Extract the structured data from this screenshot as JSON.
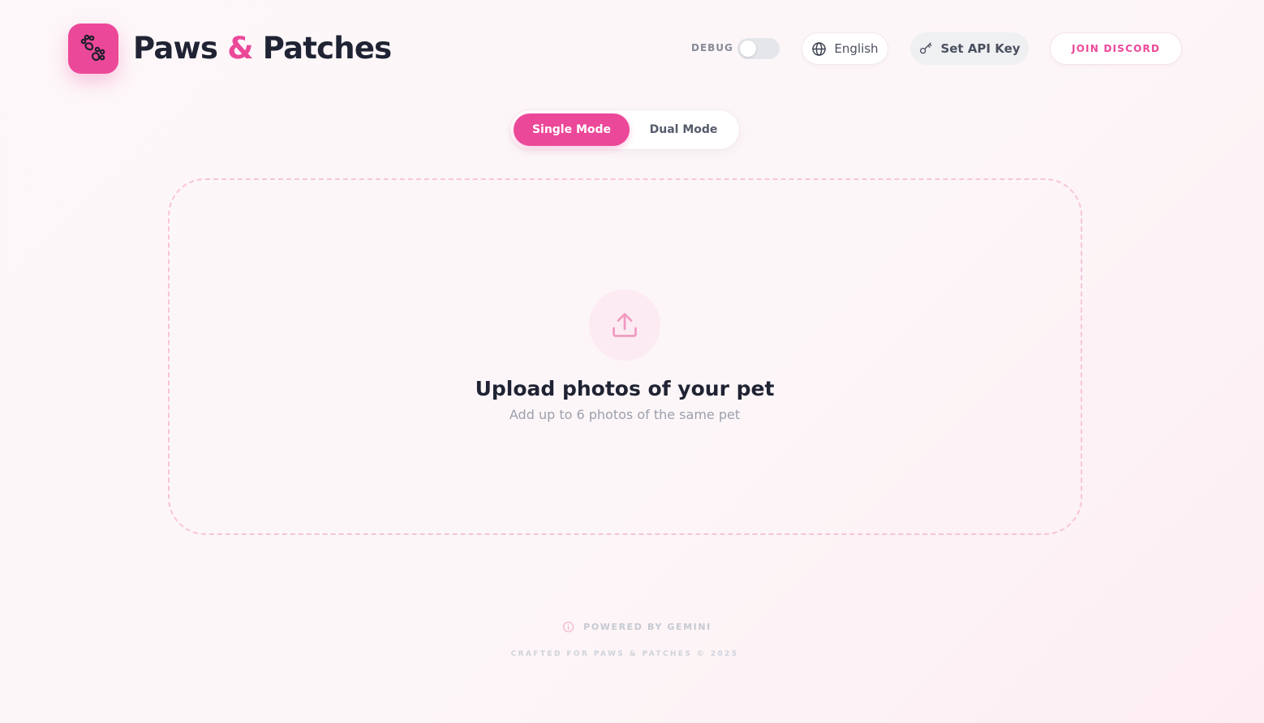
{
  "header": {
    "brand_part1": "Paws",
    "brand_amp": "&",
    "brand_part2": "Patches",
    "logo_icon": "paw-prints-icon",
    "debug_label": "DEBUG",
    "debug_enabled": false,
    "language_label": "English",
    "language_icon": "globe-icon",
    "api_key_label": "Set API Key",
    "api_key_icon": "key-icon",
    "discord_label": "JOIN DISCORD"
  },
  "modes": {
    "options": [
      "Single Mode",
      "Dual Mode"
    ],
    "selected": "Single Mode"
  },
  "upload": {
    "icon": "upload-icon",
    "title": "Upload photos of your pet",
    "subtitle": "Add up to 6 photos of the same pet"
  },
  "footer": {
    "powered_icon": "info-icon",
    "powered_by": "POWERED BY GEMINI",
    "crafted": "CRAFTED FOR PAWS & PATCHES © 2025"
  },
  "colors": {
    "accent": "#ec4899",
    "text_dark": "#1f2333",
    "text_muted": "#9ba0ad",
    "dropzone_border": "#f7c4da"
  }
}
